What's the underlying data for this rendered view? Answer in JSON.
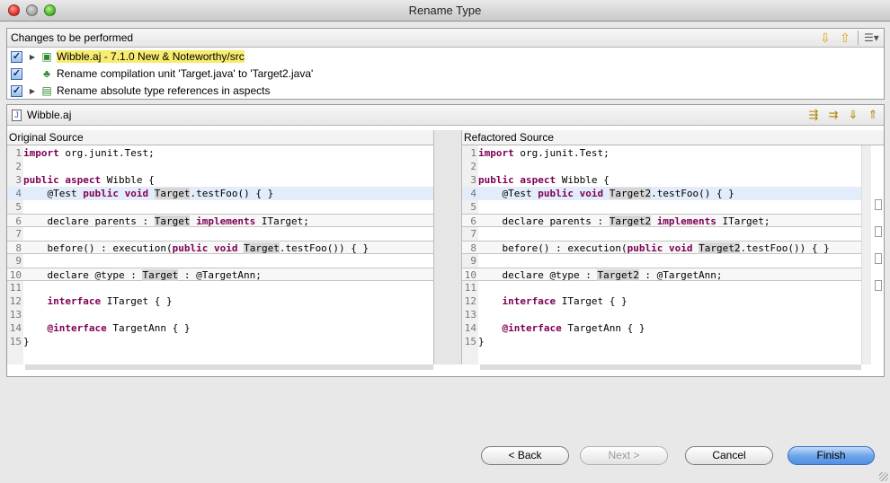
{
  "window": {
    "title": "Rename Type"
  },
  "changes": {
    "header": "Changes to be performed",
    "items": [
      {
        "label": "Wibble.aj - 7.1.0 New & Noteworthy/src",
        "checked": true,
        "expandable": true,
        "icon": "source-folder-icon"
      },
      {
        "label": "Rename compilation unit 'Target.java' to 'Target2.java'",
        "checked": true,
        "expandable": false,
        "icon": "rename-icon"
      },
      {
        "label": "Rename absolute type references in aspects",
        "checked": true,
        "expandable": true,
        "icon": "change-icon"
      }
    ]
  },
  "compare": {
    "file_name": "Wibble.aj",
    "left_title": "Original Source",
    "right_title": "Refactored Source",
    "left_lines": [
      "import org.junit.Test;",
      "",
      "public aspect Wibble {",
      "    @Test public void Target.testFoo() { }",
      "",
      "    declare parents : Target implements ITarget;",
      "",
      "    before() : execution(public void Target.testFoo()) { }",
      "",
      "    declare @type : Target : @TargetAnn;",
      "",
      "    interface ITarget { }",
      "",
      "    @interface TargetAnn { }",
      "}"
    ],
    "right_lines": [
      "import org.junit.Test;",
      "",
      "public aspect Wibble {",
      "    @Test public void Target2.testFoo() { }",
      "",
      "    declare parents : Target2 implements ITarget;",
      "",
      "    before() : execution(public void Target2.testFoo()) { }",
      "",
      "    declare @type : Target2 : @TargetAnn;",
      "",
      "    interface ITarget { }",
      "",
      "    @interface TargetAnn { }",
      "}"
    ]
  },
  "buttons": {
    "back": "< Back",
    "next": "Next >",
    "cancel": "Cancel",
    "finish": "Finish"
  }
}
